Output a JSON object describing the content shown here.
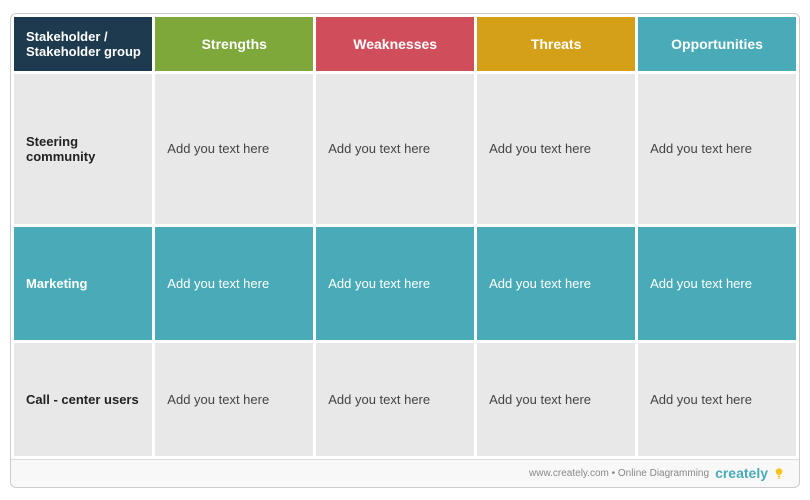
{
  "header": {
    "col_stakeholder": "Stakeholder / Stakeholder group",
    "col_strengths": "Strengths",
    "col_weaknesses": "Weaknesses",
    "col_threats": "Threats",
    "col_opps": "Opportunities"
  },
  "rows": [
    {
      "id": "row-1",
      "stakeholder": "Steering community",
      "strengths": "Add you text here",
      "weaknesses": "Add you text here",
      "threats": "Add you text here",
      "opps": "Add you text here"
    },
    {
      "id": "row-2",
      "stakeholder": "Marketing",
      "strengths": "Add you text here",
      "weaknesses": "Add you text here",
      "threats": "Add you text here",
      "opps": "Add you text here"
    },
    {
      "id": "row-3",
      "stakeholder": "Call - center users",
      "strengths": "Add you text here",
      "weaknesses": "Add you text here",
      "threats": "Add you text here",
      "opps": "Add you text here"
    }
  ],
  "footer": {
    "url_text": "www.creately.com • Online Diagramming",
    "brand": "creately"
  }
}
